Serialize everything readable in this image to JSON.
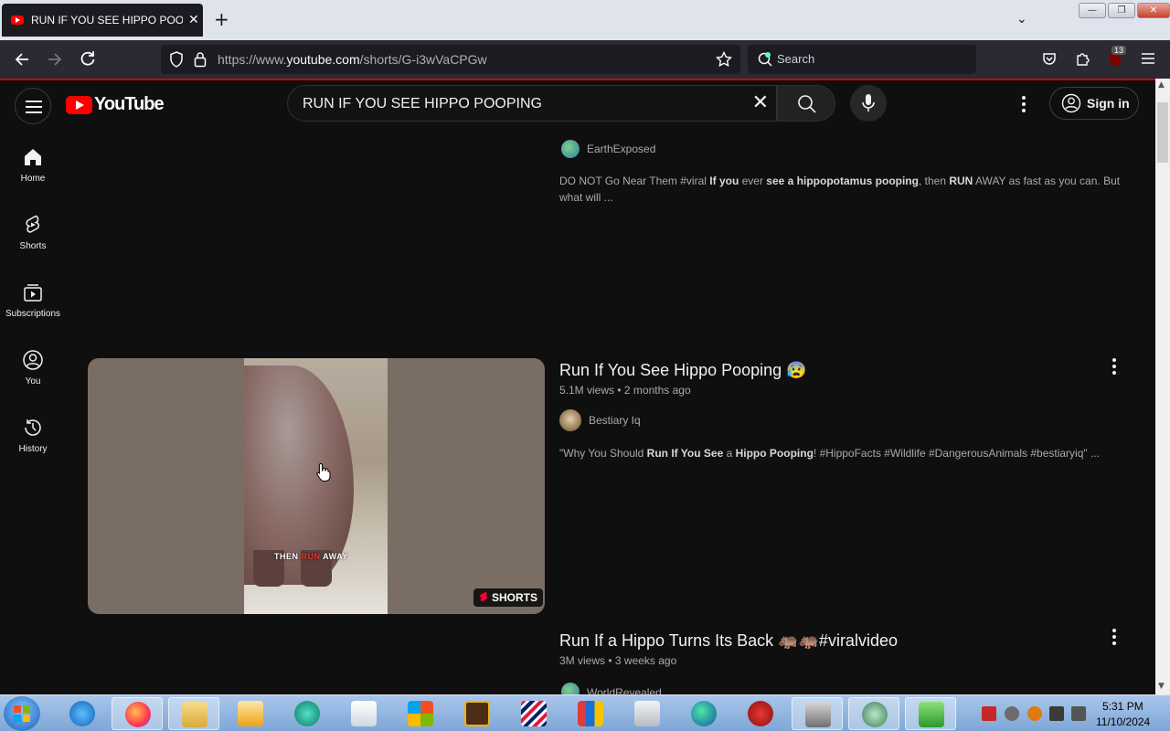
{
  "browser": {
    "tab_title": "RUN IF YOU SEE HIPPO POOPIN",
    "tab_close": "✕",
    "new_tab": "+",
    "list_all_tabs": "⌄",
    "url_prefix": "https://www.",
    "url_domain": "youtube.com",
    "url_path": "/shorts/G-i3wVaCPGw",
    "search_placeholder": "Search",
    "extension_badge": "13",
    "win_min": "—",
    "win_restore": "❐",
    "win_close": "✕"
  },
  "youtube": {
    "logo_text": "YouTube",
    "search_query": "RUN IF YOU SEE HIPPO POOPING",
    "search_clear": "✕",
    "sign_in": "Sign in",
    "guide": [
      {
        "label": "Home",
        "icon": "home-icon"
      },
      {
        "label": "Shorts",
        "icon": "shorts-icon"
      },
      {
        "label": "Subscriptions",
        "icon": "subscriptions-icon"
      },
      {
        "label": "You",
        "icon": "you-icon"
      },
      {
        "label": "History",
        "icon": "history-icon"
      }
    ],
    "results": [
      {
        "channel": "EarthExposed",
        "snippet_parts": [
          "DO NOT Go Near Them #viral ",
          "If you",
          " ever ",
          "see a hippopotamus pooping",
          ", then ",
          "RUN",
          " AWAY as fast as you can. But what will ..."
        ]
      },
      {
        "title": "Run If You See Hippo Pooping 😰",
        "views": "5.1M views",
        "age": "2 months ago",
        "channel": "Bestiary Iq",
        "snippet_parts": [
          "\"Why You Should ",
          "Run If You See",
          " a ",
          "Hippo Pooping",
          "! #HippoFacts #Wildlife #DangerousAnimals #bestiaryiq\" ..."
        ],
        "thumb_caption_1": "THEN ",
        "thumb_caption_2": "RUN",
        "thumb_caption_3": " AWAY",
        "badge": "SHORTS"
      },
      {
        "title": "Run If a Hippo Turns Its Back 🦛🦛#viralvideo",
        "views": "3M views",
        "age": "3 weeks ago",
        "channel": "WorldRevealed"
      }
    ]
  },
  "taskbar": {
    "time": "5:31 PM",
    "date": "11/10/2024"
  },
  "colors": {
    "yt_bg": "#0f0f0f",
    "yt_red": "#ff0000",
    "browser_dark": "#2b2a33",
    "taskbar": "#7ea6d6"
  }
}
